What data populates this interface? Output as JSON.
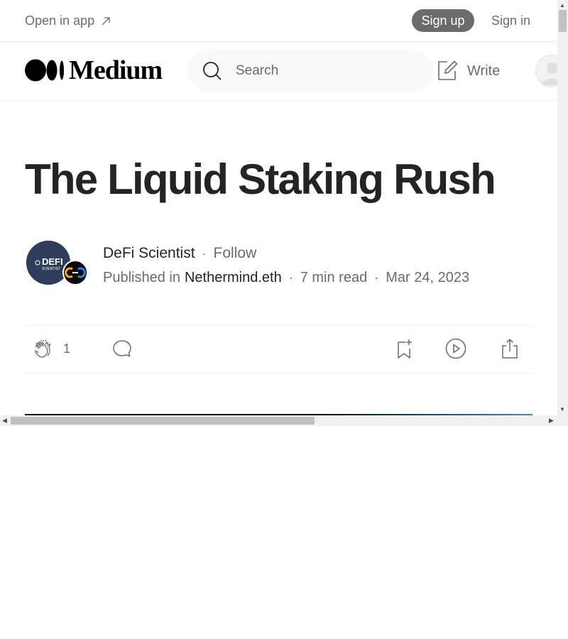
{
  "banner": {
    "open_in_app": "Open in app",
    "sign_up": "Sign up",
    "sign_in": "Sign in"
  },
  "nav": {
    "logo_text": "Medium",
    "search_placeholder": "Search",
    "write_label": "Write"
  },
  "article": {
    "title": "The Liquid Staking Rush",
    "author": "DeFi Scientist",
    "separator": "·",
    "follow": "Follow",
    "published_in_label": "Published in",
    "publication": "Nethermind.eth",
    "read_time": "7 min read",
    "date": "Mar 24, 2023",
    "author_avatar_text": "DEFI",
    "author_avatar_subtext": "SCIENTIST"
  },
  "actions": {
    "clap_count": "1"
  },
  "icons": {
    "open_in_app": "arrow-up-right-icon",
    "search": "search-icon",
    "write": "write-icon",
    "clap": "clap-icon",
    "respond": "comment-icon",
    "save": "bookmark-plus-icon",
    "listen": "play-icon",
    "share": "share-icon"
  },
  "colors": {
    "text_primary": "#242424",
    "text_secondary": "#6b6b6b",
    "signup_bg": "#6b6b6b",
    "search_bg": "#f9f9f9"
  }
}
